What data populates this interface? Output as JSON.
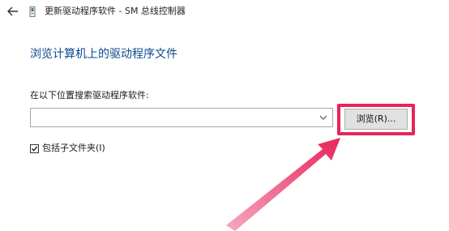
{
  "header": {
    "title": "更新驱动程序软件 - SM 总线控制器"
  },
  "main": {
    "heading": "浏览计算机上的驱动程序文件",
    "search_label": "在以下位置搜索驱动程序软件:",
    "path_value": "",
    "browse_label": "浏览(R)...",
    "include_subfolders": {
      "label": "包括子文件夹(I)",
      "checked": true
    }
  },
  "colors": {
    "heading": "#0d4a8c",
    "annotation": "#e8245a"
  },
  "icons": [
    "back-arrow-icon",
    "device-icon",
    "chevron-down-icon",
    "checkmark-icon",
    "annotation-arrow"
  ]
}
